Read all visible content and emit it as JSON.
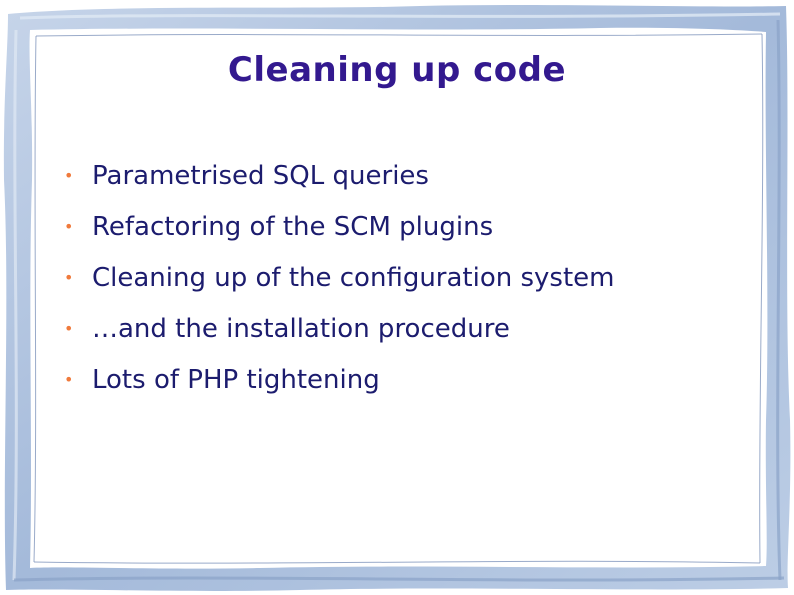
{
  "slide": {
    "title": "Cleaning up code",
    "bullet_color": "#f07a3c",
    "text_color": "#1c1c6e",
    "title_color": "#33198f",
    "frame_color": "#a9bfdc",
    "bullets": [
      "Parametrised SQL queries",
      "Refactoring of the SCM plugins",
      "Cleaning up of the configuration system",
      "…and the installation procedure",
      "Lots of PHP tightening"
    ]
  }
}
